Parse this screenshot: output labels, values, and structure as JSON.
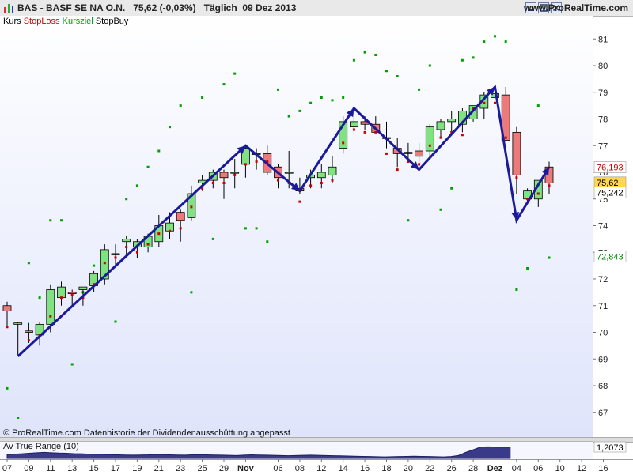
{
  "header": {
    "title": "BAS - BASF SE NA O.N.",
    "price": "75,62 (-0,03%)",
    "period": "Täglich",
    "date": "09 Dez 2013",
    "site": "www.ProRealTime.com",
    "icons": [
      "chart-icon",
      "minimize-icon",
      "maximize-icon",
      "close-icon"
    ]
  },
  "legend": [
    {
      "text": "Kurs",
      "color": "#000000"
    },
    {
      "text": "StopLoss",
      "color": "#d00000"
    },
    {
      "text": "Kursziel",
      "color": "#00a000"
    },
    {
      "text": "StopBuy",
      "color": "#000000"
    }
  ],
  "footer": "© ProRealTime.com  Datenhistorie der Dividendenausschüttung angepasst",
  "atr": {
    "label": "Av True Range (10)",
    "value": "1,2073",
    "values": [
      0.78,
      0.8,
      0.82,
      0.85,
      0.88,
      0.9,
      0.88,
      0.86,
      0.85,
      0.83,
      0.82,
      0.8,
      0.79,
      0.78,
      0.77,
      0.76,
      0.75,
      0.74,
      0.75,
      0.76,
      0.78,
      0.77,
      0.76,
      0.75,
      0.74,
      0.76,
      0.77,
      0.76,
      0.75,
      0.74,
      0.73,
      0.72,
      0.74,
      0.76,
      0.75,
      0.74,
      0.73,
      0.72,
      0.71,
      0.72,
      0.73,
      0.74,
      0.73,
      0.72,
      0.71,
      0.7,
      0.69,
      0.68,
      0.67,
      0.66,
      0.65,
      0.64,
      0.65,
      0.66,
      0.67,
      0.68,
      0.67,
      0.66,
      0.65,
      0.64,
      0.66,
      0.72,
      0.9,
      1.05,
      1.21,
      1.22,
      1.21,
      1.2,
      1.2073
    ]
  },
  "price_labels": [
    {
      "text": "76,193",
      "value": 76.193,
      "color": "#d00000",
      "bg": "#ffffff"
    },
    {
      "text": "75,62",
      "value": 75.62,
      "color": "#000000",
      "bg": "#ffd84d"
    },
    {
      "text": "75,242",
      "value": 75.242,
      "color": "#000000",
      "bg": "#ffffff"
    },
    {
      "text": "72,843",
      "value": 72.843,
      "color": "#008a00",
      "bg": "#ffffff"
    }
  ],
  "colors": {
    "up": "#80e280",
    "down": "#ec7a7a",
    "trend": "#1a1a9a",
    "stoploss": "#d00000",
    "target": "#00a000"
  },
  "chart_data": {
    "type": "candlestick",
    "ylim": [
      66.2,
      81.7
    ],
    "yticks": [
      67,
      68,
      69,
      70,
      71,
      72,
      73,
      74,
      75,
      76,
      77,
      78,
      79,
      80,
      81
    ],
    "xticks": [
      "07",
      "09",
      "11",
      "13",
      "15",
      "17",
      "19",
      "21",
      "23",
      "25",
      "29",
      "Nov",
      "06",
      "08",
      "12",
      "14",
      "16",
      "18",
      "20",
      "22",
      "26",
      "28",
      "Dez",
      "04",
      "06",
      "10",
      "12",
      "16"
    ],
    "xtick_index": [
      0,
      2,
      4,
      6,
      8,
      10,
      12,
      14,
      16,
      18,
      20,
      22,
      25,
      27,
      29,
      31,
      33,
      35,
      37,
      39,
      41,
      43,
      45,
      47,
      49,
      51,
      53,
      55
    ],
    "candles": [
      [
        71.0,
        71.15,
        70.25,
        70.8
      ],
      [
        70.3,
        70.4,
        69.15,
        70.35
      ],
      [
        70.0,
        70.35,
        69.6,
        70.05
      ],
      [
        69.9,
        70.4,
        69.5,
        70.3
      ],
      [
        70.3,
        71.8,
        70.0,
        71.6
      ],
      [
        71.3,
        71.9,
        71.0,
        71.7
      ],
      [
        71.5,
        71.6,
        71.0,
        71.45
      ],
      [
        71.6,
        71.7,
        71.0,
        71.7
      ],
      [
        71.75,
        72.3,
        71.5,
        72.2
      ],
      [
        72.0,
        73.3,
        71.8,
        73.1
      ],
      [
        72.9,
        73.3,
        72.5,
        72.95
      ],
      [
        73.4,
        73.6,
        72.9,
        73.5
      ],
      [
        73.2,
        73.5,
        72.8,
        73.4
      ],
      [
        73.2,
        73.7,
        73.0,
        73.6
      ],
      [
        73.4,
        74.4,
        73.2,
        74.0
      ],
      [
        73.8,
        74.5,
        73.5,
        74.1
      ],
      [
        74.5,
        74.6,
        73.4,
        74.2
      ],
      [
        74.3,
        75.5,
        74.2,
        75.2
      ],
      [
        75.6,
        75.9,
        75.3,
        75.7
      ],
      [
        75.7,
        76.1,
        75.4,
        76.0
      ],
      [
        76.0,
        76.1,
        75.0,
        75.8
      ],
      [
        76.0,
        76.5,
        75.4,
        76.0
      ],
      [
        76.3,
        77.0,
        75.8,
        76.9
      ],
      [
        76.7,
        76.9,
        76.1,
        76.7
      ],
      [
        76.7,
        77.0,
        75.9,
        76.0
      ],
      [
        76.2,
        76.3,
        75.4,
        75.8
      ],
      [
        76.0,
        76.8,
        75.4,
        76.0
      ],
      [
        75.4,
        75.8,
        75.2,
        75.3
      ],
      [
        75.8,
        76.1,
        75.4,
        75.9
      ],
      [
        75.8,
        76.3,
        75.4,
        76.0
      ],
      [
        75.9,
        76.6,
        75.6,
        76.2
      ],
      [
        76.9,
        78.1,
        76.7,
        77.9
      ],
      [
        77.7,
        78.3,
        77.5,
        77.9
      ],
      [
        77.9,
        78.1,
        77.6,
        77.8
      ],
      [
        77.8,
        78.1,
        77.5,
        77.5
      ],
      [
        77.3,
        77.9,
        76.9,
        77.3
      ],
      [
        76.9,
        77.3,
        76.2,
        76.7
      ],
      [
        76.75,
        77.1,
        76.5,
        76.7
      ],
      [
        76.8,
        77.1,
        76.2,
        76.6
      ],
      [
        76.8,
        77.8,
        76.5,
        77.7
      ],
      [
        77.6,
        78.0,
        77.3,
        77.9
      ],
      [
        77.9,
        78.3,
        77.5,
        78.0
      ],
      [
        77.8,
        78.4,
        77.5,
        78.3
      ],
      [
        78.0,
        78.5,
        77.9,
        78.5
      ],
      [
        78.4,
        79.0,
        78.0,
        78.9
      ],
      [
        78.8,
        79.1,
        78.5,
        78.95
      ],
      [
        78.9,
        79.2,
        77.2,
        77.2
      ],
      [
        77.5,
        77.7,
        75.2,
        75.9
      ],
      [
        75.0,
        75.4,
        74.9,
        75.3
      ],
      [
        75.0,
        75.7,
        74.7,
        75.7
      ],
      [
        76.2,
        76.4,
        75.2,
        75.6
      ]
    ],
    "stoploss": [
      [
        0,
        70.2
      ],
      [
        2,
        69.7
      ],
      [
        3,
        69.9
      ],
      [
        4,
        70.6
      ],
      [
        5,
        71.3
      ],
      [
        6,
        71.4
      ],
      [
        7,
        71.3
      ],
      [
        8,
        71.8
      ],
      [
        9,
        72.6
      ],
      [
        10,
        72.8
      ],
      [
        11,
        73.2
      ],
      [
        12,
        73.0
      ],
      [
        13,
        73.3
      ],
      [
        14,
        73.7
      ],
      [
        15,
        73.8
      ],
      [
        16,
        73.9
      ],
      [
        17,
        74.7
      ],
      [
        18,
        75.4
      ],
      [
        19,
        75.6
      ],
      [
        20,
        75.6
      ],
      [
        21,
        75.9
      ],
      [
        22,
        76.3
      ],
      [
        23,
        76.4
      ],
      [
        24,
        76.4
      ],
      [
        25,
        75.7
      ],
      [
        26,
        75.6
      ],
      [
        27,
        74.9
      ],
      [
        28,
        75.5
      ],
      [
        29,
        75.6
      ],
      [
        30,
        75.7
      ],
      [
        31,
        77.1
      ],
      [
        32,
        77.6
      ],
      [
        33,
        77.5
      ],
      [
        34,
        77.5
      ],
      [
        35,
        76.7
      ],
      [
        36,
        76.1
      ],
      [
        37,
        76.4
      ],
      [
        38,
        76.3
      ],
      [
        39,
        77.0
      ],
      [
        40,
        77.3
      ],
      [
        41,
        77.5
      ],
      [
        42,
        77.4
      ],
      [
        43,
        78.4
      ],
      [
        44,
        78.6
      ],
      [
        45,
        78.6
      ],
      [
        46,
        77.3
      ],
      [
        47,
        75.8
      ],
      [
        48,
        75.0
      ],
      [
        49,
        75.2
      ],
      [
        50,
        75.5
      ]
    ],
    "targets": [
      [
        0,
        67.9
      ],
      [
        1,
        66.8
      ],
      [
        2,
        72.6
      ],
      [
        3,
        71.3
      ],
      [
        4,
        74.2
      ],
      [
        5,
        74.2
      ],
      [
        6,
        68.8
      ],
      [
        7,
        71.5
      ],
      [
        8,
        72.5
      ],
      [
        9,
        72.9
      ],
      [
        10,
        70.4
      ],
      [
        11,
        75.0
      ],
      [
        12,
        75.5
      ],
      [
        13,
        76.2
      ],
      [
        14,
        76.8
      ],
      [
        15,
        77.7
      ],
      [
        16,
        78.5
      ],
      [
        17,
        71.5
      ],
      [
        18,
        78.8
      ],
      [
        19,
        73.5
      ],
      [
        20,
        79.3
      ],
      [
        21,
        79.7
      ],
      [
        22,
        73.9
      ],
      [
        23,
        73.9
      ],
      [
        24,
        73.4
      ],
      [
        25,
        79.1
      ],
      [
        26,
        78.1
      ],
      [
        27,
        78.3
      ],
      [
        28,
        78.6
      ],
      [
        29,
        78.8
      ],
      [
        30,
        78.7
      ],
      [
        31,
        78.8
      ],
      [
        32,
        80.2
      ],
      [
        33,
        80.5
      ],
      [
        34,
        80.4
      ],
      [
        35,
        79.8
      ],
      [
        36,
        79.6
      ],
      [
        37,
        74.2
      ],
      [
        38,
        79.1
      ],
      [
        39,
        80.0
      ],
      [
        40,
        74.6
      ],
      [
        41,
        75.4
      ],
      [
        42,
        80.2
      ],
      [
        43,
        80.3
      ],
      [
        44,
        80.9
      ],
      [
        45,
        81.1
      ],
      [
        46,
        80.9
      ],
      [
        47,
        71.6
      ],
      [
        48,
        72.4
      ],
      [
        49,
        78.5
      ],
      [
        50,
        72.8
      ]
    ],
    "trend": [
      [
        1,
        69.1
      ],
      [
        22,
        77.0
      ],
      [
        27,
        75.3
      ],
      [
        32,
        78.4
      ],
      [
        38,
        76.1
      ],
      [
        45,
        79.2
      ],
      [
        47,
        74.2
      ],
      [
        50,
        76.2
      ]
    ]
  }
}
